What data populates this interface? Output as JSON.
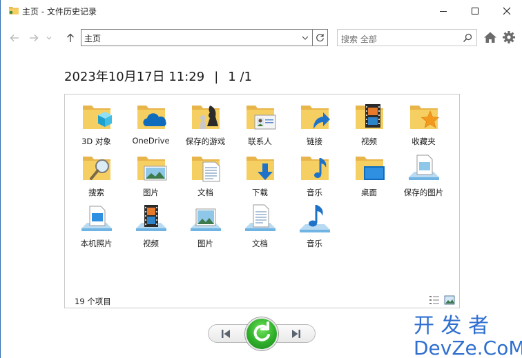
{
  "window": {
    "title": "主页 - 文件历史记录",
    "accent_color": "#2b6cb0",
    "controls": {
      "minimize": "minimize-icon",
      "maximize": "maximize-icon",
      "close": "close-icon"
    }
  },
  "navigation": {
    "back": "arrow-left-icon",
    "forward": "arrow-right-icon",
    "recent": "chevron-down-icon",
    "up": "arrow-up-icon",
    "address": "主页",
    "search_placeholder": "搜索 全部"
  },
  "backup": {
    "datetime": "2023年10月17日 11:29",
    "separator": "|",
    "page_indicator": "1 /1"
  },
  "items": [
    {
      "label": "3D 对象",
      "icon": "folder-3d-objects-icon"
    },
    {
      "label": "OneDrive",
      "icon": "folder-onedrive-icon"
    },
    {
      "label": "保存的游戏",
      "icon": "folder-saved-games-icon"
    },
    {
      "label": "联系人",
      "icon": "folder-contacts-icon"
    },
    {
      "label": "链接",
      "icon": "folder-links-icon"
    },
    {
      "label": "视频",
      "icon": "folder-videos-icon"
    },
    {
      "label": "收藏夹",
      "icon": "folder-favorites-icon"
    },
    {
      "label": "搜索",
      "icon": "folder-searches-icon"
    },
    {
      "label": "图片",
      "icon": "folder-pictures-icon"
    },
    {
      "label": "文档",
      "icon": "folder-documents-icon"
    },
    {
      "label": "下载",
      "icon": "folder-downloads-icon"
    },
    {
      "label": "音乐",
      "icon": "folder-music-icon"
    },
    {
      "label": "桌面",
      "icon": "folder-desktop-icon"
    },
    {
      "label": "保存的图片",
      "icon": "library-saved-pictures-icon"
    },
    {
      "label": "本机照片",
      "icon": "library-camera-roll-icon"
    },
    {
      "label": "视频",
      "icon": "library-videos-icon"
    },
    {
      "label": "图片",
      "icon": "library-pictures-icon"
    },
    {
      "label": "文档",
      "icon": "library-documents-icon"
    },
    {
      "label": "音乐",
      "icon": "library-music-icon"
    }
  ],
  "status": {
    "item_count": "19 个项目"
  },
  "playback": {
    "previous": "skip-previous-icon",
    "restore": "restore-icon",
    "next": "skip-next-icon"
  },
  "watermark": {
    "line1": "开 发 者",
    "line2": "DevZe.CoM"
  }
}
